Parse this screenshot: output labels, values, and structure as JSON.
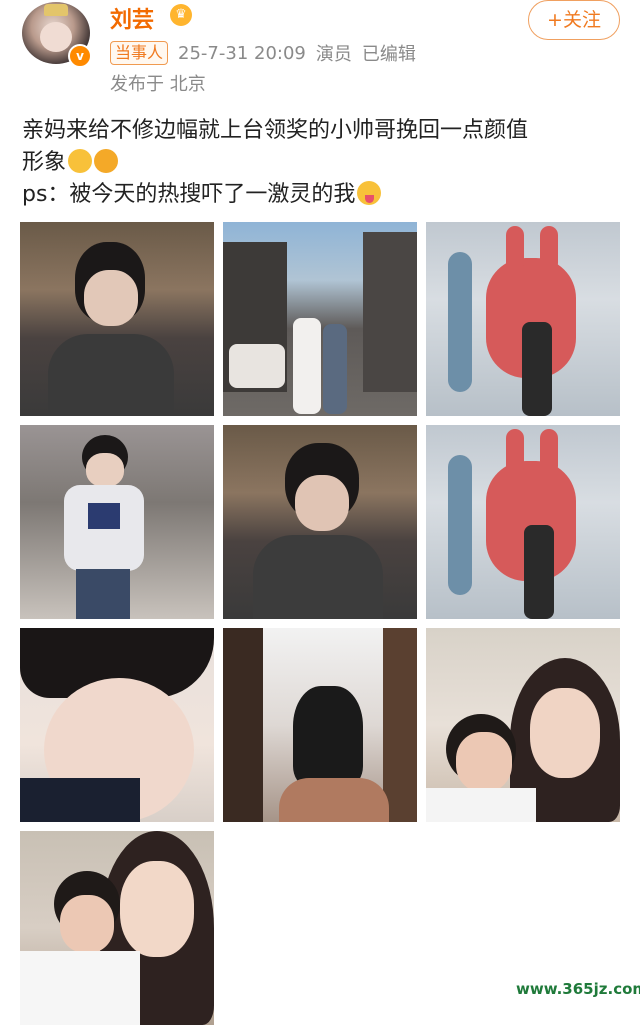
{
  "user": {
    "name": "刘芸",
    "avatar_icon": "avatar-photo",
    "verified_icon": "v-badge-icon",
    "vip_icon": "crown-badge-icon",
    "badge_glyph": "v"
  },
  "follow_button": {
    "label": "+关注"
  },
  "meta": {
    "tag": "当事人",
    "timestamp": "25-7-31 20:09",
    "role": "演员",
    "edited": "已编辑",
    "location": "发布于 北京"
  },
  "post": {
    "line1": "亲妈来给不修边幅就上台领奖的小帅哥挽回一点颜值",
    "line2": "形象",
    "line3": "ps：被今天的热搜吓了一激灵的我",
    "emoji1": "sleepy-face-emoji",
    "emoji2": "rolling-laughing-emoji",
    "emoji3": "tongue-face-emoji"
  },
  "photos": [
    {
      "name": "photo-1"
    },
    {
      "name": "photo-2"
    },
    {
      "name": "photo-3"
    },
    {
      "name": "photo-4"
    },
    {
      "name": "photo-5"
    },
    {
      "name": "photo-6"
    },
    {
      "name": "photo-7"
    },
    {
      "name": "photo-8"
    },
    {
      "name": "photo-9"
    },
    {
      "name": "photo-10"
    }
  ],
  "colors": {
    "username": "#f26a00",
    "follow": "#f07a20",
    "meta_text": "#8a8a8a",
    "watermark": "#1f7a3a"
  },
  "watermark": "www.365jz.com"
}
